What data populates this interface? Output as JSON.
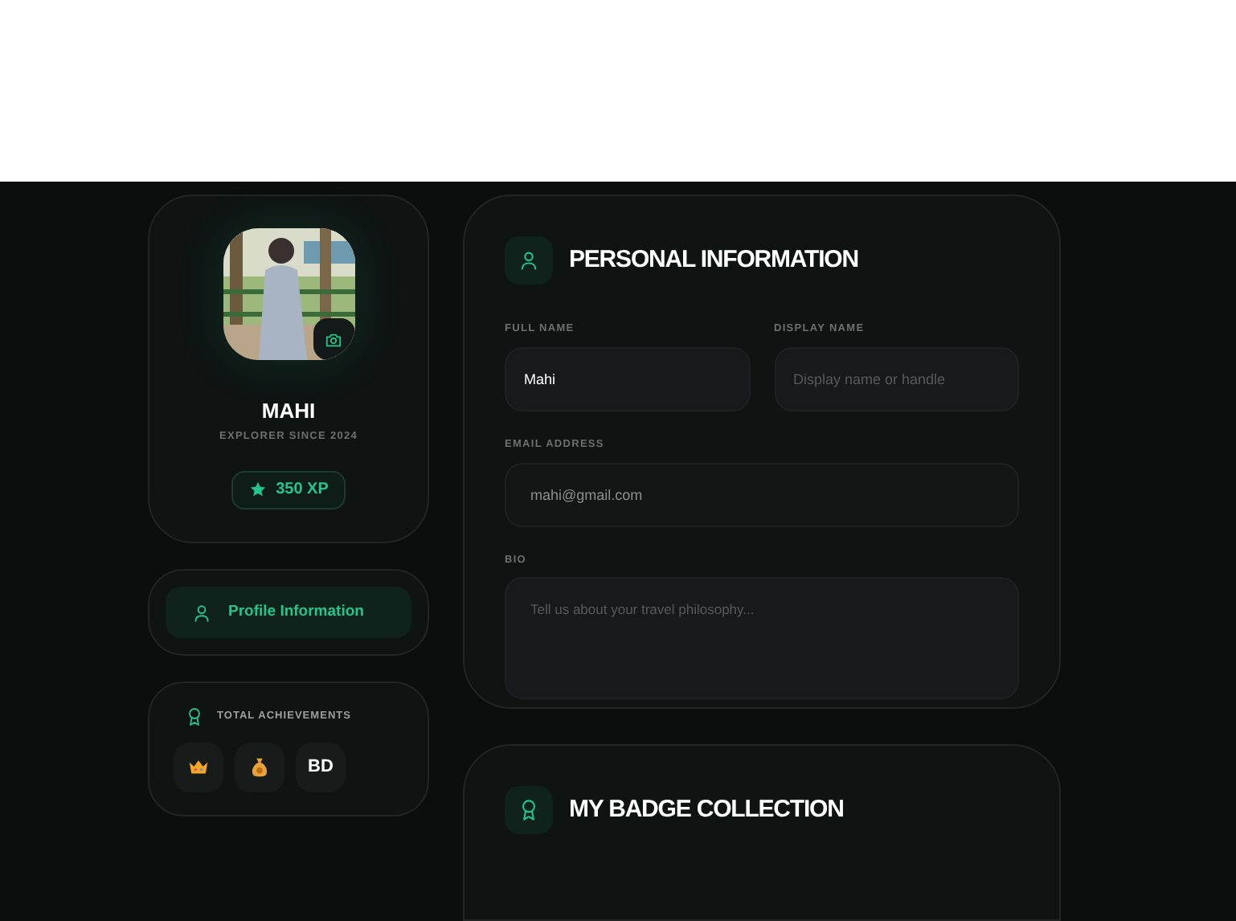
{
  "profile": {
    "name": "MAHI",
    "subtitle": "EXPLORER SINCE 2024",
    "xp": "350 XP"
  },
  "nav": [
    {
      "label": "Profile Information",
      "selected": true
    }
  ],
  "achievements": {
    "title": "TOTAL ACHIEVEMENTS",
    "items": [
      {
        "kind": "crown"
      },
      {
        "kind": "money-bag"
      },
      {
        "kind": "text",
        "label": "BD"
      }
    ]
  },
  "personal_information": {
    "title": "PERSONAL INFORMATION",
    "fields": [
      {
        "label": "FULL NAME",
        "value": "Mahi",
        "kind": "input"
      },
      {
        "label": "DISPLAY NAME",
        "placeholder": "Display name or handle",
        "kind": "input"
      },
      {
        "label": "EMAIL ADDRESS",
        "value": "mahi@gmail.com",
        "kind": "input",
        "disabled": true,
        "wide": true
      },
      {
        "label": "BIO",
        "placeholder": "Tell us about your travel philosophy...",
        "kind": "textarea",
        "wide": true
      }
    ]
  },
  "badge_collection": {
    "title": "MY BADGE COLLECTION"
  }
}
